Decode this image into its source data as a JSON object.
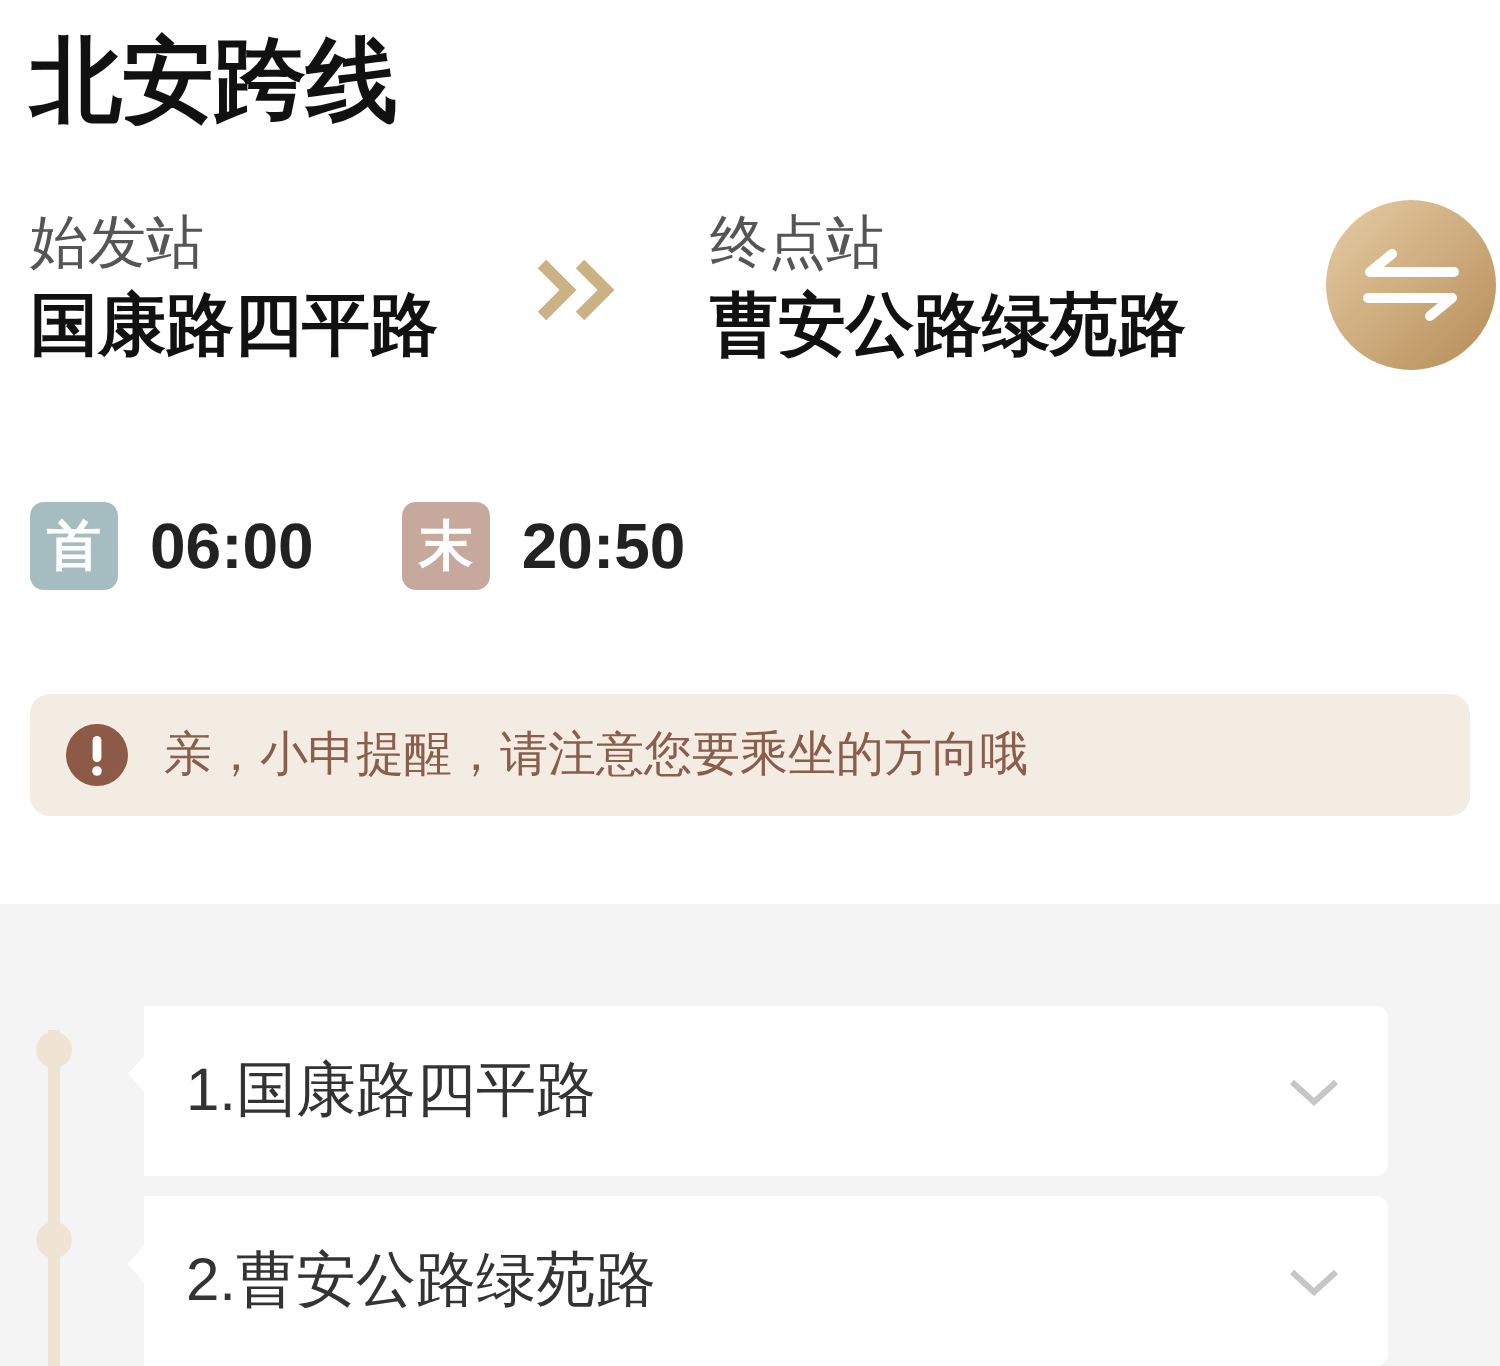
{
  "title": "北安跨线",
  "route": {
    "start": {
      "label": "始发站",
      "name": "国康路四平路"
    },
    "end": {
      "label": "终点站",
      "name": "曹安公路绿苑路"
    }
  },
  "service_hours": [
    {
      "kind": "first",
      "badge": "首",
      "time": "06:00"
    },
    {
      "kind": "last",
      "badge": "末",
      "time": "20:50"
    }
  ],
  "notice": {
    "text": "亲，小申提醒，请注意您要乘坐的方向哦"
  },
  "stops": [
    {
      "label": "1.国康路四平路",
      "expanded": false
    },
    {
      "label": "2.曹安公路绿苑路",
      "expanded": false
    }
  ]
}
